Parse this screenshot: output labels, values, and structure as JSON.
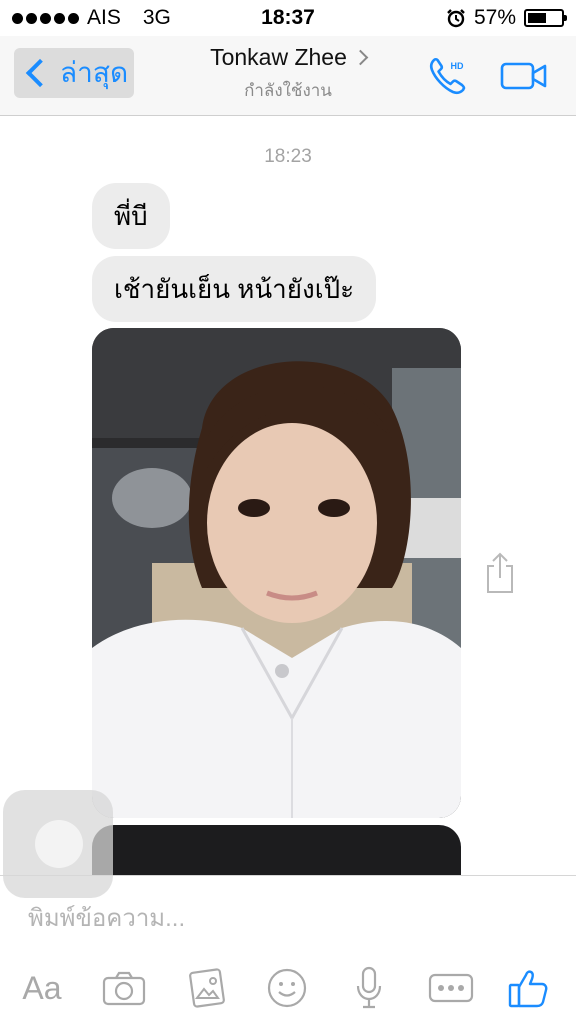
{
  "status_bar": {
    "carrier": "AIS",
    "network": "3G",
    "time": "18:37",
    "battery_text": "57%",
    "battery_level": 0.57
  },
  "header": {
    "back_label": "ล่าสุด",
    "contact_name": "Tonkaw Zhee",
    "status": "กำลังใช้งาน",
    "call_badge": "HD"
  },
  "conversation": {
    "timestamp": "18:23",
    "messages": [
      {
        "text": "พี่บี"
      },
      {
        "text": "เช้ายันเย็น หน้ายังเป๊ะ"
      }
    ]
  },
  "composer": {
    "placeholder": "พิมพ์ข้อความ...",
    "font_button_label": "Aa"
  },
  "colors": {
    "accent": "#1a8cff",
    "bubble": "#ececec",
    "icon_gray": "#a9a9a9"
  }
}
